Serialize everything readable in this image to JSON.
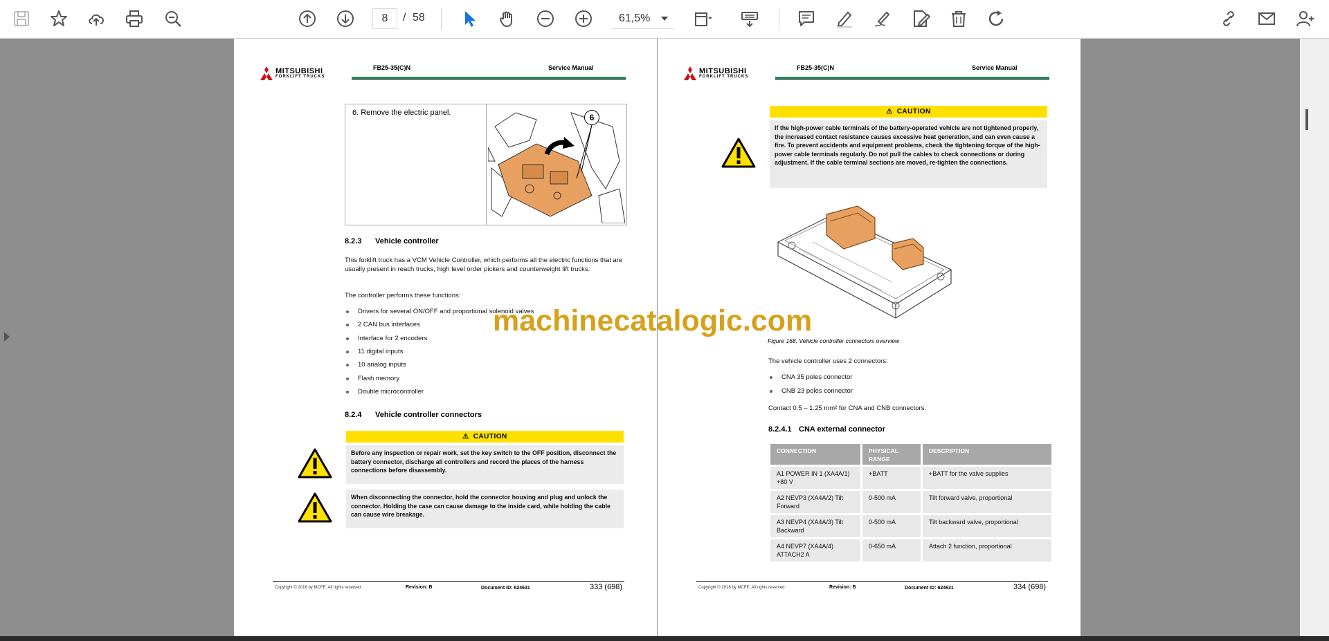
{
  "toolbar": {
    "page_current": "8",
    "page_separator": "/",
    "page_total": "58",
    "zoom": "61,5%"
  },
  "icons": [
    "save-icon",
    "bookmark-star-icon",
    "upload-cloud-icon",
    "print-icon",
    "zoom-search-icon",
    "scroll-up-icon",
    "scroll-down-icon",
    "select-cursor-icon",
    "hand-pan-icon",
    "zoom-out-icon",
    "zoom-in-icon",
    "page-fit-icon",
    "keyboard-icon",
    "comment-icon",
    "highlight-pen-icon",
    "sign-pen-icon",
    "edit-doc-icon",
    "delete-icon",
    "rotate-icon",
    "share-link-icon",
    "email-icon",
    "add-user-icon"
  ],
  "watermark": "machinecatalogic.com",
  "left_page": {
    "logo": "MITSUBISHI",
    "logo_sub": "FORKLIFT TRUCKS",
    "model": "FB25-35(C)N",
    "header_title": "Service Manual",
    "step_text": "6.   Remove the electric panel.",
    "callout_number": "6",
    "sec1_num": "8.2.3",
    "sec1_title": "Vehicle controller",
    "para1": "This forklift truck has a VCM Vehicle Controller, which performs all the electric functions that are usually present in reach trucks, high level order pickers and counterweight lift trucks.",
    "para2": "The controller performs these functions:",
    "bullets": [
      "Drivers for several ON/OFF and proportional solenoid valves",
      "2 CAN bus interfaces",
      "Interface for 2 encoders",
      "11 digital inputs",
      "10 analog inputs",
      "Flash memory",
      "Double microcontroller"
    ],
    "sec2_num": "8.2.4",
    "sec2_title": "Vehicle controller connectors",
    "caution_label": "CAUTION",
    "caution1": "Before any inspection or repair work, set the key switch to the OFF position, disconnect the battery connector, discharge all controllers and record the places of the harness connections before disassembly.",
    "caution2": "When disconnecting the connector, hold the connector housing and plug and unlock the connector. Holding the case can cause damage to the inside card, while holding the cable can cause wire breakage.",
    "foot_copy": "Copyright © 2016 by MCFE. All rights reserved.",
    "foot_rev": "Revision: B",
    "foot_doc": "Document ID: 624631",
    "foot_page": "333 (698)"
  },
  "right_page": {
    "logo": "MITSUBISHI",
    "logo_sub": "FORKLIFT TRUCKS",
    "model": "FB25-35(C)N",
    "header_title": "Service Manual",
    "caution_label": "CAUTION",
    "caution1": "If the high-power cable terminals of the battery-operated vehicle are not tightened properly, the increased contact resistance causes excessive heat generation, and can even cause a fire. To prevent accidents and equipment problems, check the tightening torque of the high-power cable terminals regularly. Do not pull the cables to check connections or during adjustment. If the cable terminal sections are moved, re-tighten the connections.",
    "figure_caption": "Figure 168. Vehicle controller connectors overview",
    "para1": "The vehicle controller uses 2 connectors:",
    "bullets": [
      "CNA 35 poles connector",
      "CNB 23 poles connector"
    ],
    "para2": "Contact 0.5 – 1.25 mm² for CNA and CNB connectors.",
    "sec_num": "8.2.4.1",
    "sec_title": "CNA external connector",
    "table_headers": [
      "CONNECTION",
      "PHYSICAL RANGE",
      "DESCRIPTION"
    ],
    "table_rows": [
      [
        "A1 POWER IN 1 (XA4A/1) +80 V",
        "+BATT",
        "+BATT for the valve supplies"
      ],
      [
        "A2 NEVP3 (XA4A/2) Tilt Forward",
        "0-500 mA",
        "Tilt forward valve, proportional"
      ],
      [
        "A3 NEVP4 (XA4A/3) Tilt Backward",
        "0-500 mA",
        "Tilt backward valve, proportional"
      ],
      [
        "A4 NEVP7 (XA4A/4) ATTACH2 A",
        "0-650 mA",
        "Attach 2 function, proportional"
      ]
    ],
    "foot_copy": "Copyright © 2016 by MCFE. All rights reserved.",
    "foot_rev": "Revision: B",
    "foot_doc": "Document ID: 624631",
    "foot_page": "334 (698)"
  },
  "colors": {
    "caution_yellow": "#ffe000",
    "header_green": "#1a8a5a",
    "mitsubishi_red": "#d0121b",
    "watermark": "#d6a11b",
    "connector_orange": "#e8a060",
    "select_blue": "#1473e6"
  }
}
